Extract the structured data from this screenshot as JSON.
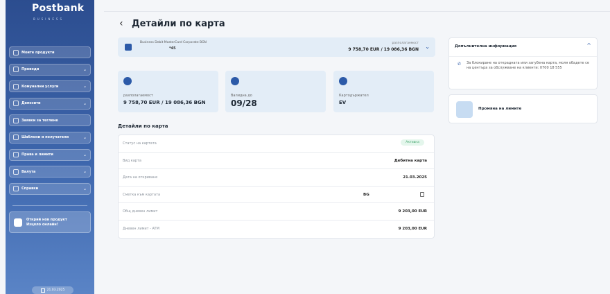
{
  "sidebar": {
    "logo": "Postbank",
    "logo_sub": "BUSINESS",
    "items": [
      {
        "label": "Моите продукти",
        "chevron": ""
      },
      {
        "label": "Преводи",
        "chevron": "⌄"
      },
      {
        "label": "Комунални услуги",
        "chevron": "⌄"
      },
      {
        "label": "Депозити",
        "chevron": "⌄"
      },
      {
        "label": "Заявки за теглене",
        "chevron": ""
      },
      {
        "label": "Шаблони и получатели",
        "chevron": "⌄"
      },
      {
        "label": "Права и лимити",
        "chevron": "⌄"
      },
      {
        "label": "Валута",
        "chevron": "⌄"
      },
      {
        "label": "Справки",
        "chevron": "⌄"
      }
    ],
    "promo": {
      "line1": "Открий нов продукт",
      "line2": "Изцяло онлайн!"
    },
    "date": "21.03.2025"
  },
  "header": {
    "back_icon": "‹",
    "title": "Детайли по карта"
  },
  "card_strip": {
    "name": "Business Debit MasterCard Corporate BGN",
    "number": "*45",
    "available_label": "разполагаемост",
    "available_value": "9 758,70 EUR / 19 086,36 BGN",
    "chevron": "⌄"
  },
  "tiles": [
    {
      "label": "разполагаемост",
      "value": "9 758,70 EUR / 19 086,36 BGN"
    },
    {
      "label": "Валидна до",
      "value": "09/28"
    },
    {
      "label": "Картодържател",
      "value": "EV"
    }
  ],
  "details": {
    "title": "Детайли по карта",
    "rows": [
      {
        "label": "Статус на картата",
        "value": "Активна"
      },
      {
        "label": "Вид карта",
        "value": "Дебитна карта"
      },
      {
        "label": "Дата на откриване",
        "value": "21.03.2025"
      },
      {
        "label": "Сметка към картата",
        "value": "BG"
      },
      {
        "label": "Общ дневен лимит",
        "value": "9 203,00 EUR"
      },
      {
        "label": "Дневен лимит - ATM",
        "value": "9 203,00 EUR"
      }
    ]
  },
  "info_panel": {
    "title": "Допълнителна информация",
    "chevron": "^",
    "text": "За блокиране на открадната или загубена карта, моля обадете се на центъра за обслужване на клиенти: 0700 18 555"
  },
  "limits_panel": {
    "label": "Промяна на лимите"
  },
  "colors": {
    "sidebar_top": "#2c4d8f",
    "accent": "#2c5aa8",
    "status_green": "#3fa36b"
  }
}
